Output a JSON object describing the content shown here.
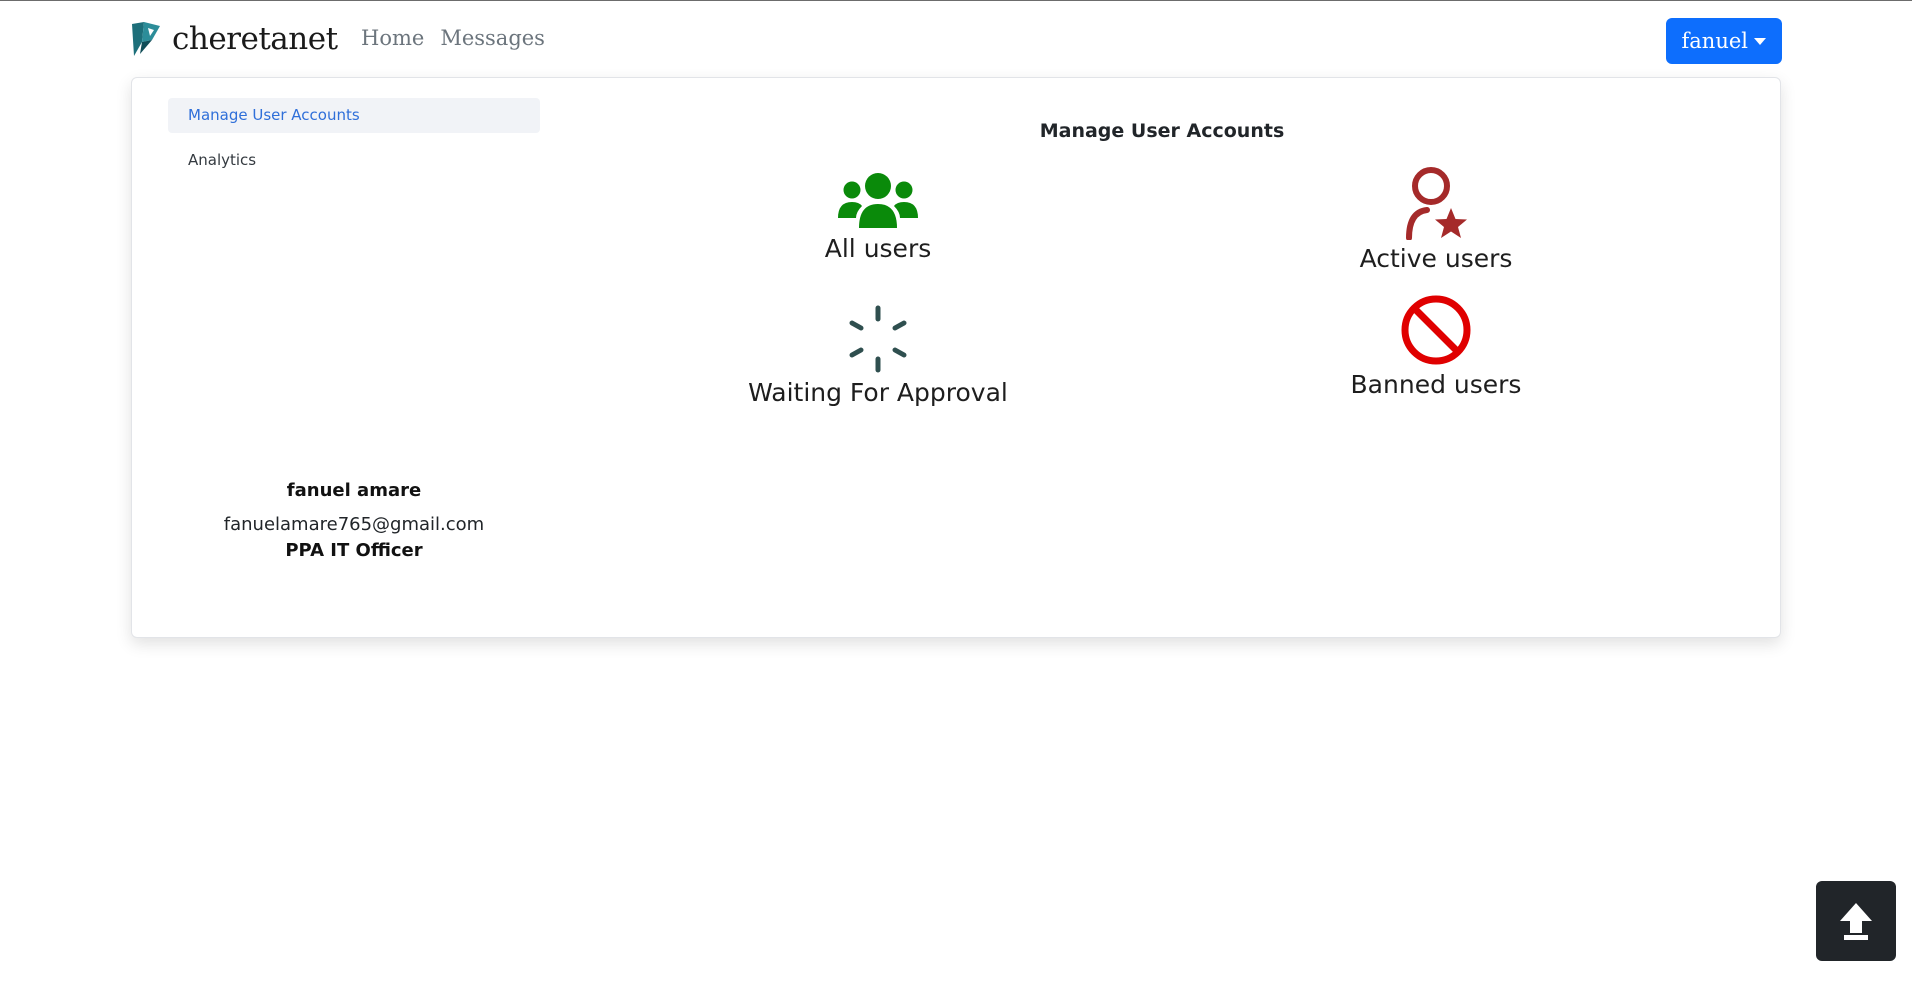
{
  "brand": {
    "name": "cheretanet",
    "logo_icon": "cheretanet-logo-icon"
  },
  "nav": {
    "links": [
      "Home",
      "Messages"
    ],
    "user_menu_label": "fanuel"
  },
  "sidebar": {
    "items": [
      {
        "label": "Manage User Accounts",
        "active": true
      },
      {
        "label": "Analytics",
        "active": false
      }
    ]
  },
  "profile": {
    "name": "fanuel amare",
    "email": "fanuelamare765@gmail.com",
    "role": "PPA IT Officer"
  },
  "main": {
    "title": "Manage User Accounts",
    "tiles": [
      {
        "label": "All users",
        "icon": "users-group-icon",
        "color": "#0a8a0a"
      },
      {
        "label": "Active users",
        "icon": "user-star-icon",
        "color": "#a52a2a"
      },
      {
        "label": "Waiting For Approval",
        "icon": "spinner-icon",
        "color": "#2f4f4f"
      },
      {
        "label": "Banned users",
        "icon": "ban-icon",
        "color": "#e00000"
      }
    ]
  },
  "colors": {
    "primary": "#0d6efd",
    "active_link": "#2f6fd9",
    "dark_button": "#212529"
  }
}
